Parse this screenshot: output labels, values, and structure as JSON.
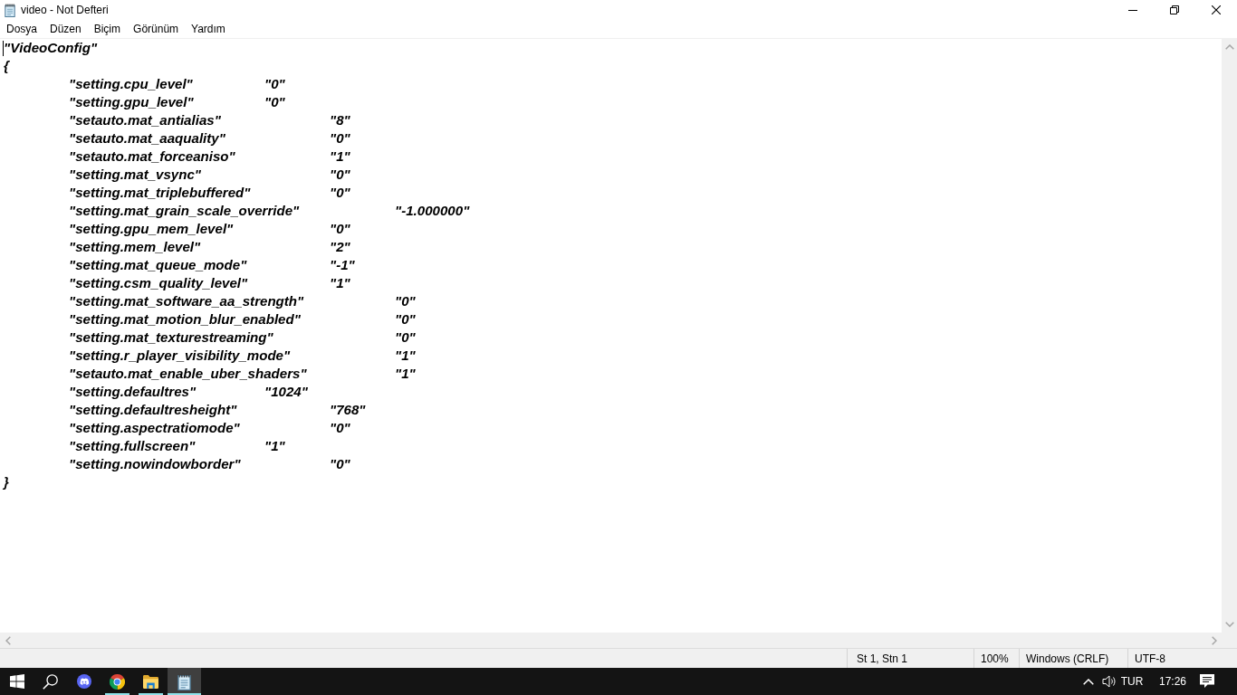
{
  "window": {
    "title": "video - Not Defteri"
  },
  "menu": [
    "Dosya",
    "Düzen",
    "Biçim",
    "Görünüm",
    "Yardım"
  ],
  "editor": {
    "lines": [
      "\"VideoConfig\"",
      "{",
      "\t\"setting.cpu_level\"\t\t\"0\"",
      "\t\"setting.gpu_level\"\t\t\"0\"",
      "\t\"setauto.mat_antialias\"\t\t\"8\"",
      "\t\"setauto.mat_aaquality\"\t\t\"0\"",
      "\t\"setauto.mat_forceaniso\"\t\t\"1\"",
      "\t\"setting.mat_vsync\"\t\t\"0\"",
      "\t\"setting.mat_triplebuffered\"\t\t\"0\"",
      "\t\"setting.mat_grain_scale_override\"\t\t\"-1.000000\"",
      "\t\"setting.gpu_mem_level\"\t\t\"0\"",
      "\t\"setting.mem_level\"\t\t\"2\"",
      "\t\"setting.mat_queue_mode\"\t\t\"-1\"",
      "\t\"setting.csm_quality_level\"\t\t\"1\"",
      "\t\"setting.mat_software_aa_strength\"\t\t\"0\"",
      "\t\"setting.mat_motion_blur_enabled\"\t\t\"0\"",
      "\t\"setting.mat_texturestreaming\"\t\t\"0\"",
      "\t\"setting.r_player_visibility_mode\"\t\t\"1\"",
      "\t\"setauto.mat_enable_uber_shaders\"\t\t\"1\"",
      "\t\"setting.defaultres\"\t\t\"1024\"",
      "\t\"setting.defaultresheight\"\t\t\"768\"",
      "\t\"setting.aspectratiomode\"\t\t\"0\"",
      "\t\"setting.fullscreen\"\t\t\"1\"",
      "\t\"setting.nowindowborder\"\t\t\"0\"",
      "}"
    ]
  },
  "status_bar": {
    "cursor_position": "St 1, Stn 1",
    "zoom": "100%",
    "line_ending": "Windows (CRLF)",
    "encoding": "UTF-8"
  },
  "taskbar": {
    "apps": [
      {
        "kind": "chat",
        "running": false,
        "selected": false
      },
      {
        "kind": "browser",
        "running": true,
        "selected": false
      },
      {
        "kind": "folder",
        "running": true,
        "selected": false
      },
      {
        "kind": "notepad",
        "running": true,
        "selected": true
      }
    ],
    "tray": {
      "language": "TUR",
      "time": "17:26"
    }
  }
}
